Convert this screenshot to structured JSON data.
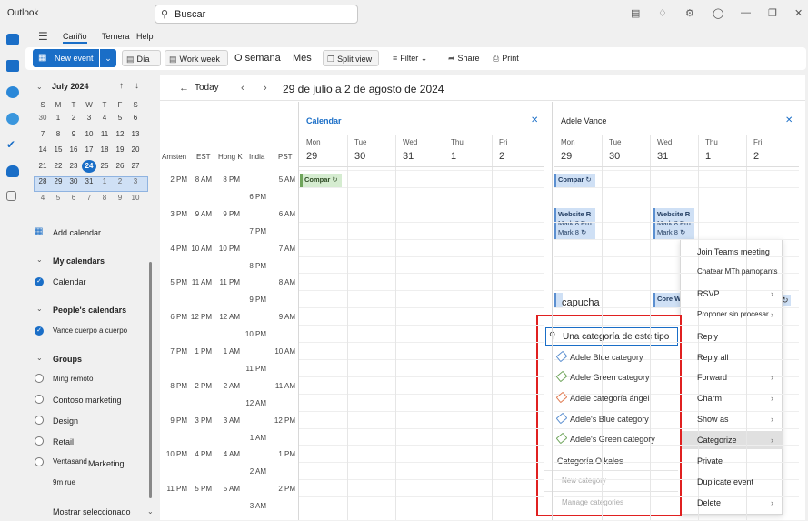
{
  "app": {
    "title": "Outlook"
  },
  "search": {
    "text": "Buscar"
  },
  "menu": {
    "items": [
      "Cariño",
      "Ternera",
      "Help"
    ]
  },
  "ribbon": {
    "new_event": "New event",
    "day": "Día",
    "work_week": "Work week",
    "week": "O semana",
    "month": "Mes",
    "split_view": "Split view",
    "filter": "Filter",
    "share": "Share",
    "print": "Print"
  },
  "mini_calendar": {
    "month_label": "July 2024",
    "weekdays": [
      "S",
      "M",
      "T",
      "W",
      "T",
      "F",
      "S"
    ],
    "weeks": [
      [
        "",
        "1",
        "2",
        "3",
        "4",
        "5",
        "6"
      ],
      [
        "30",
        "1",
        "2",
        "3",
        "4",
        "5",
        "6"
      ],
      [
        "7",
        "8",
        "9",
        "10",
        "11",
        "12",
        "13"
      ],
      [
        "14",
        "15",
        "16",
        "17",
        "18",
        "19",
        "20"
      ],
      [
        "21",
        "22",
        "23",
        "24",
        "25",
        "26",
        "27"
      ],
      [
        "28",
        "29",
        "30",
        "31",
        "1",
        "2",
        "3"
      ],
      [
        "4",
        "5",
        "6",
        "7",
        "8",
        "9",
        "10"
      ]
    ],
    "today": "24"
  },
  "sidebar": {
    "add_calendar": "Add calendar",
    "my_calendars": "My calendars",
    "calendar": "Calendar",
    "peoples_calendars": "People's calendars",
    "vance": "Vance cuerpo a cuerpo",
    "groups": "Groups",
    "group_items": [
      "Ming remoto",
      "Contoso marketing",
      "Design",
      "Retail",
      "Ventasand",
      "Marketing",
      "9m rue"
    ],
    "show_selected": "Mostrar seleccionado"
  },
  "calendar": {
    "today_button": "Today",
    "date_range": "29 de julio a 2 de agosto de 2024",
    "timezones": [
      "Amsten",
      "EST",
      "Hong K",
      "India",
      "PST"
    ],
    "time_rows": [
      [
        "2 PM",
        "8 AM",
        "8 PM",
        "",
        "5 AM"
      ],
      [
        "",
        "",
        "",
        "6 PM",
        ""
      ],
      [
        "3 PM",
        "9 AM",
        "9 PM",
        "",
        "6 AM"
      ],
      [
        "",
        "",
        "",
        "7 PM",
        ""
      ],
      [
        "4 PM",
        "10 AM",
        "10 PM",
        "",
        "7 AM"
      ],
      [
        "",
        "",
        "",
        "8 PM",
        ""
      ],
      [
        "5 PM",
        "11 AM",
        "11 PM",
        "",
        "8 AM"
      ],
      [
        "",
        "",
        "",
        "9 PM",
        ""
      ],
      [
        "6 PM",
        "12 PM",
        "12 AM",
        "",
        "9 AM"
      ],
      [
        "",
        "",
        "",
        "10 PM",
        ""
      ],
      [
        "7 PM",
        "1 PM",
        "1 AM",
        "",
        "10 AM"
      ],
      [
        "",
        "",
        "",
        "11 PM",
        ""
      ],
      [
        "8 PM",
        "2 PM",
        "2 AM",
        "",
        "11 AM"
      ],
      [
        "",
        "",
        "",
        "12 AM",
        ""
      ],
      [
        "9 PM",
        "3 PM",
        "3 AM",
        "",
        "12 PM"
      ],
      [
        "",
        "",
        "",
        "1 AM",
        ""
      ],
      [
        "10 PM",
        "4 PM",
        "4 AM",
        "",
        "1 PM"
      ],
      [
        "",
        "",
        "",
        "2 AM",
        ""
      ],
      [
        "11 PM",
        "5 PM",
        "5 AM",
        "",
        "2 PM"
      ],
      [
        "",
        "",
        "",
        "3 AM",
        ""
      ]
    ],
    "panels": [
      {
        "title": "Calendar",
        "days": [
          [
            "Mon",
            "29"
          ],
          [
            "Tue",
            "30"
          ],
          [
            "Wed",
            "31"
          ],
          [
            "Thu",
            "1"
          ],
          [
            "Fri",
            "2"
          ]
        ]
      },
      {
        "title": "Adele Vance",
        "days": [
          [
            "Mon",
            "29"
          ],
          [
            "Tue",
            "30"
          ],
          [
            "Wed",
            "31"
          ],
          [
            "Thu",
            "1"
          ],
          [
            "Fri",
            "2"
          ]
        ]
      }
    ],
    "events": {
      "compar1": "Compar",
      "compar2": "Compar",
      "website1": [
        "Website R",
        "Mark 8 Pro",
        "Mark 8"
      ],
      "website2": [
        "Website R",
        "Mark 8 Pro",
        "Mark 8"
      ],
      "core": "Core W",
      "capucha": "capucha"
    }
  },
  "context_menu": {
    "items": [
      {
        "label": "Join Teams meeting",
        "chev": false
      },
      {
        "label": "Chatear MTh pamopants",
        "chev": false
      },
      {
        "label": "RSVP",
        "chev": true
      },
      {
        "label": "Proponer sin procesar",
        "chev": true
      },
      {
        "label": "Reply",
        "chev": false
      },
      {
        "label": "Reply all",
        "chev": false
      },
      {
        "label": "Forward",
        "chev": true
      },
      {
        "label": "Charm",
        "chev": true
      },
      {
        "label": "Show as",
        "chev": true
      },
      {
        "label": "Categorize",
        "chev": true
      },
      {
        "label": "Private",
        "chev": false
      },
      {
        "label": "Duplicate event",
        "chev": false
      },
      {
        "label": "Delete",
        "chev": true
      }
    ]
  },
  "categorize_menu": {
    "search_placeholder": "Una categoría de este tipo",
    "categories": [
      {
        "label": "Adele Blue category",
        "color": "#5b8fd0"
      },
      {
        "label": "Adele Green category",
        "color": "#6fa55b"
      },
      {
        "label": "Adele categoría ángel",
        "color": "#e07a50"
      },
      {
        "label": "Adele's Blue category",
        "color": "#5b8fd0"
      },
      {
        "label": "Adele's Green category",
        "color": "#6fa55b"
      }
    ],
    "other": "Categoría O kales",
    "new_category": "New category",
    "manage_categories": "Manage categories"
  }
}
